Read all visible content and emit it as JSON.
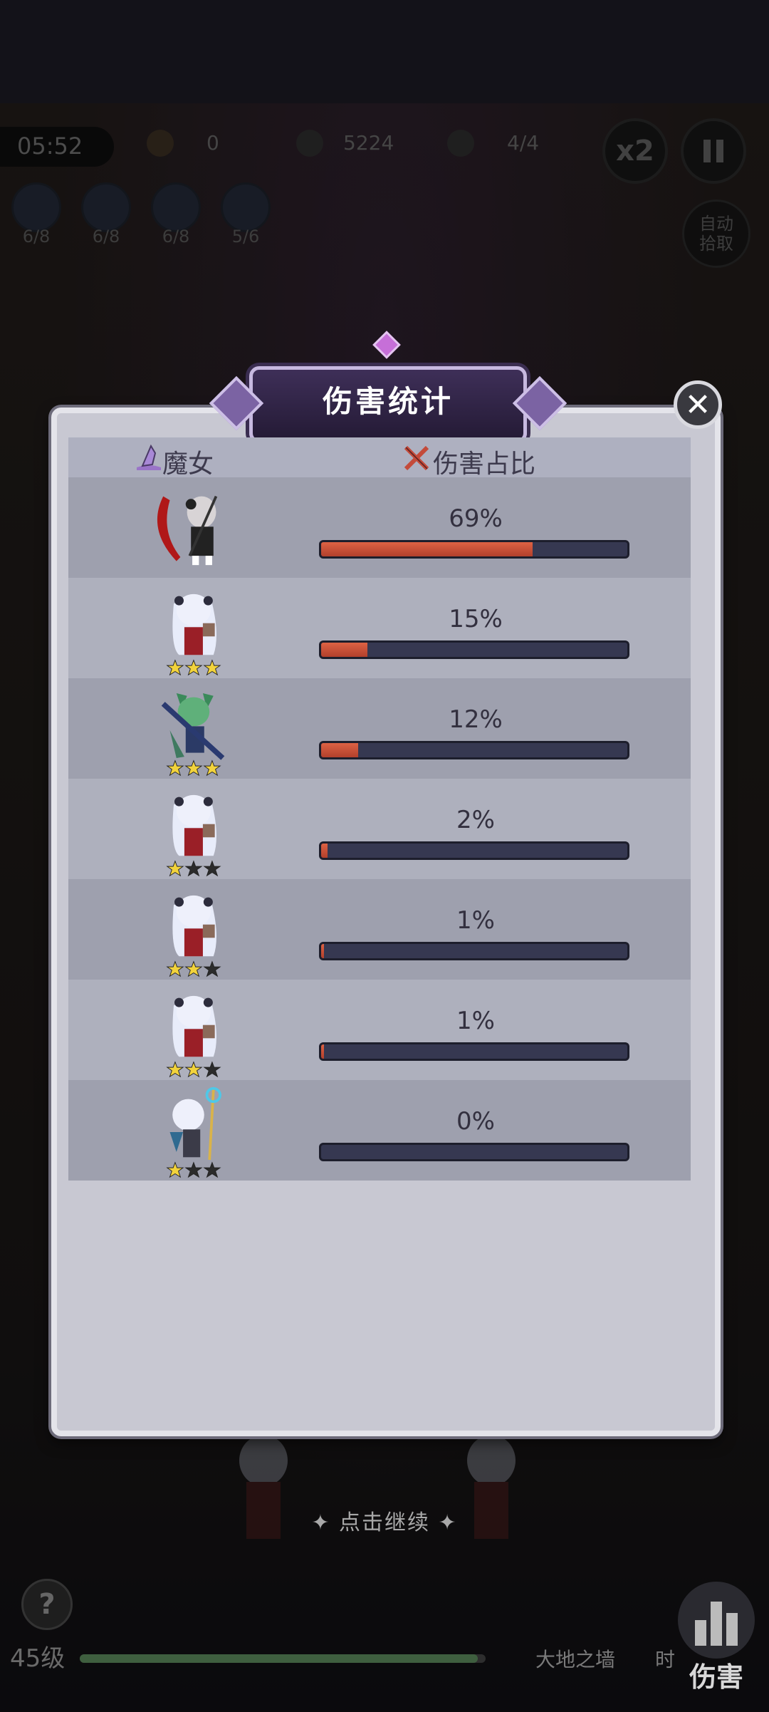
{
  "hud": {
    "timer": "05:52",
    "coins": "0",
    "kills": "5224",
    "wave": "4/4",
    "speed_label": "x2",
    "auto_pickup": "自动拾取"
  },
  "skills": [
    "6/8",
    "6/8",
    "6/8",
    "5/6"
  ],
  "dialog": {
    "title": "伤害统计",
    "close_icon": "close-icon",
    "header": {
      "hero_col": "魔女",
      "damage_col": "伤害占比"
    },
    "rows": [
      {
        "percent_label": "69%",
        "share": 0.69,
        "stars": 0,
        "avatar": "scythe-witch"
      },
      {
        "percent_label": "15%",
        "share": 0.15,
        "stars": 3,
        "avatar": "white-hair-witch"
      },
      {
        "percent_label": "12%",
        "share": 0.12,
        "stars": 3,
        "avatar": "green-hair-gunner"
      },
      {
        "percent_label": "2%",
        "share": 0.02,
        "stars": 1,
        "avatar": "white-hair-witch"
      },
      {
        "percent_label": "1%",
        "share": 0.01,
        "stars": 2,
        "avatar": "white-hair-witch"
      },
      {
        "percent_label": "1%",
        "share": 0.01,
        "stars": 2,
        "avatar": "white-hair-witch"
      },
      {
        "percent_label": "0%",
        "share": 0.0,
        "stars": 1,
        "avatar": "staff-witch"
      }
    ]
  },
  "bottom": {
    "continue_hint": "点击继续",
    "level": "45级",
    "earth_wall": "大地之墙",
    "time_short": "时",
    "damage_button": "伤害"
  },
  "colors": {
    "bar_fill": "#d05a3e",
    "bar_track": "#363851",
    "panel_bg": "#c8c8d2",
    "star_on": "#f2d33c",
    "star_off": "#2b2b2b"
  }
}
